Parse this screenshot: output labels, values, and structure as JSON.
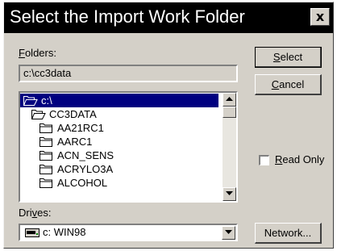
{
  "window": {
    "title": "Select the Import Work Folder",
    "close_glyph": "x"
  },
  "folders": {
    "label": "Folders:",
    "current_path": "c:\\cc3data",
    "items": [
      {
        "name": "c:\\",
        "icon": "open-folder-icon",
        "selected": true
      },
      {
        "name": "CC3DATA",
        "icon": "open-folder-icon",
        "selected": false
      },
      {
        "name": "AA21RC1",
        "icon": "folder-icon",
        "selected": false
      },
      {
        "name": "AARC1",
        "icon": "folder-icon",
        "selected": false
      },
      {
        "name": "ACN_SENS",
        "icon": "folder-icon",
        "selected": false
      },
      {
        "name": "ACRYLO3A",
        "icon": "folder-icon",
        "selected": false
      },
      {
        "name": "ALCOHOL",
        "icon": "folder-icon",
        "selected": false
      }
    ]
  },
  "drives": {
    "label": "Drives:",
    "selected": "c: WIN98",
    "icon": "hard-drive-icon"
  },
  "buttons": {
    "select": "Select",
    "cancel": "Cancel",
    "network": "Network..."
  },
  "read_only": {
    "label": "Read Only",
    "checked": false
  },
  "colors": {
    "selection": "#000080",
    "face": "#d4d0c8",
    "titlebar": "#000000"
  }
}
